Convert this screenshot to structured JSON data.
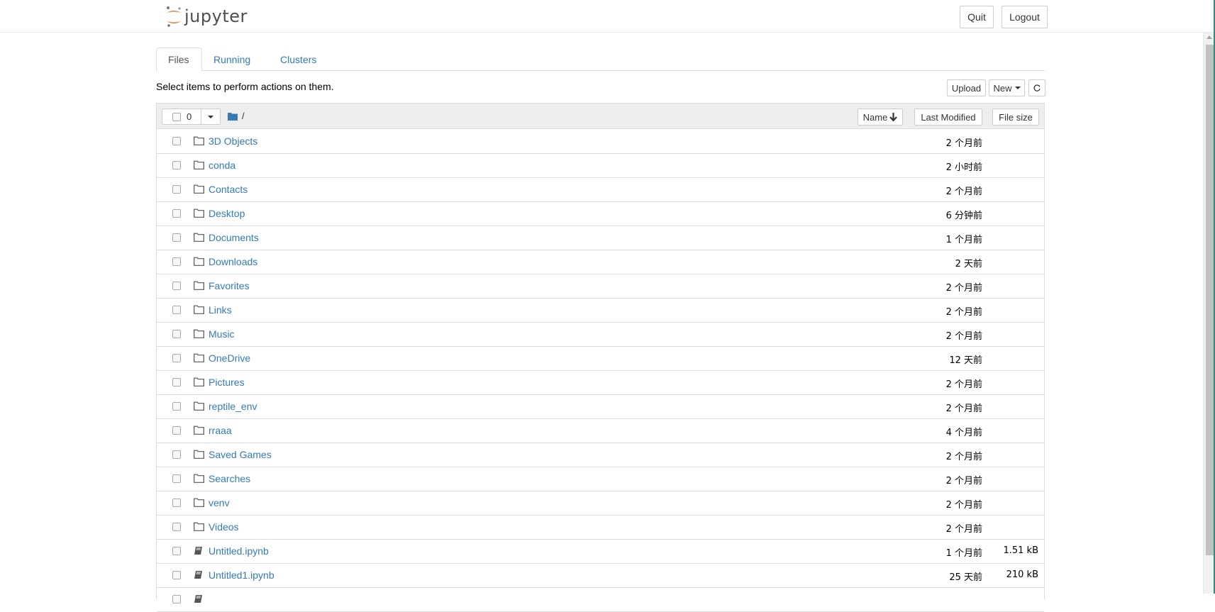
{
  "header": {
    "logo_text": "jupyter",
    "quit_label": "Quit",
    "logout_label": "Logout"
  },
  "tabs": [
    {
      "label": "Files",
      "active": true
    },
    {
      "label": "Running",
      "active": false
    },
    {
      "label": "Clusters",
      "active": false
    }
  ],
  "toolbar": {
    "select_message": "Select items to perform actions on them.",
    "upload_label": "Upload",
    "new_label": "New",
    "refresh_icon": "refresh-icon"
  },
  "list_header": {
    "selected_count": "0",
    "breadcrumb": "/",
    "sort_name_label": "Name",
    "sort_modified_label": "Last Modified",
    "sort_size_label": "File size"
  },
  "items": [
    {
      "type": "folder",
      "name": "3D Objects",
      "modified": "2 个月前",
      "size": ""
    },
    {
      "type": "folder",
      "name": "conda",
      "modified": "2 小时前",
      "size": ""
    },
    {
      "type": "folder",
      "name": "Contacts",
      "modified": "2 个月前",
      "size": ""
    },
    {
      "type": "folder",
      "name": "Desktop",
      "modified": "6 分钟前",
      "size": ""
    },
    {
      "type": "folder",
      "name": "Documents",
      "modified": "1 个月前",
      "size": ""
    },
    {
      "type": "folder",
      "name": "Downloads",
      "modified": "2 天前",
      "size": ""
    },
    {
      "type": "folder",
      "name": "Favorites",
      "modified": "2 个月前",
      "size": ""
    },
    {
      "type": "folder",
      "name": "Links",
      "modified": "2 个月前",
      "size": ""
    },
    {
      "type": "folder",
      "name": "Music",
      "modified": "2 个月前",
      "size": ""
    },
    {
      "type": "folder",
      "name": "OneDrive",
      "modified": "12 天前",
      "size": ""
    },
    {
      "type": "folder",
      "name": "Pictures",
      "modified": "2 个月前",
      "size": ""
    },
    {
      "type": "folder",
      "name": "reptile_env",
      "modified": "2 个月前",
      "size": ""
    },
    {
      "type": "folder",
      "name": "rraaa",
      "modified": "4 个月前",
      "size": ""
    },
    {
      "type": "folder",
      "name": "Saved Games",
      "modified": "2 个月前",
      "size": ""
    },
    {
      "type": "folder",
      "name": "Searches",
      "modified": "2 个月前",
      "size": ""
    },
    {
      "type": "folder",
      "name": "venv",
      "modified": "2 个月前",
      "size": ""
    },
    {
      "type": "folder",
      "name": "Videos",
      "modified": "2 个月前",
      "size": ""
    },
    {
      "type": "notebook",
      "name": "Untitled.ipynb",
      "modified": "1 个月前",
      "size": "1.51 kB"
    },
    {
      "type": "notebook",
      "name": "Untitled1.ipynb",
      "modified": "25 天前",
      "size": "210 kB"
    },
    {
      "type": "notebook",
      "name": "",
      "modified": "",
      "size": ""
    }
  ],
  "colors": {
    "link": "#337ab7",
    "logo_orange": "#f37726",
    "header_bg": "#eeeeee"
  }
}
